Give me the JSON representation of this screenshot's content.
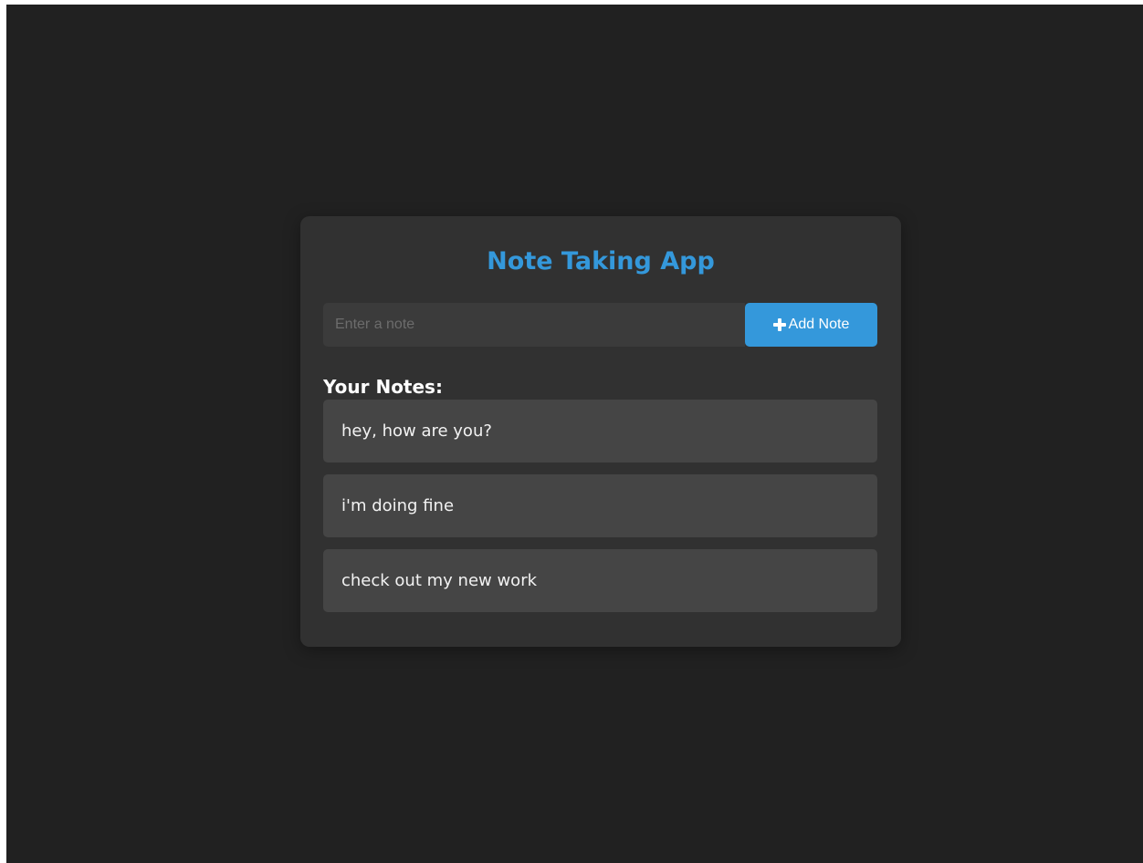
{
  "app": {
    "title": "Note Taking App"
  },
  "form": {
    "input_placeholder": "Enter a note",
    "input_value": "",
    "add_button_label": "Add Note",
    "add_button_icon": "plus-icon"
  },
  "notes": {
    "heading": "Your Notes:",
    "items": [
      {
        "text": "hey, how are you?"
      },
      {
        "text": "i'm doing fine"
      },
      {
        "text": "check out my new work"
      }
    ]
  },
  "colors": {
    "accent": "#3498db",
    "background": "#212121",
    "card": "#313131",
    "input": "#3b3b3b",
    "note": "#454545"
  }
}
